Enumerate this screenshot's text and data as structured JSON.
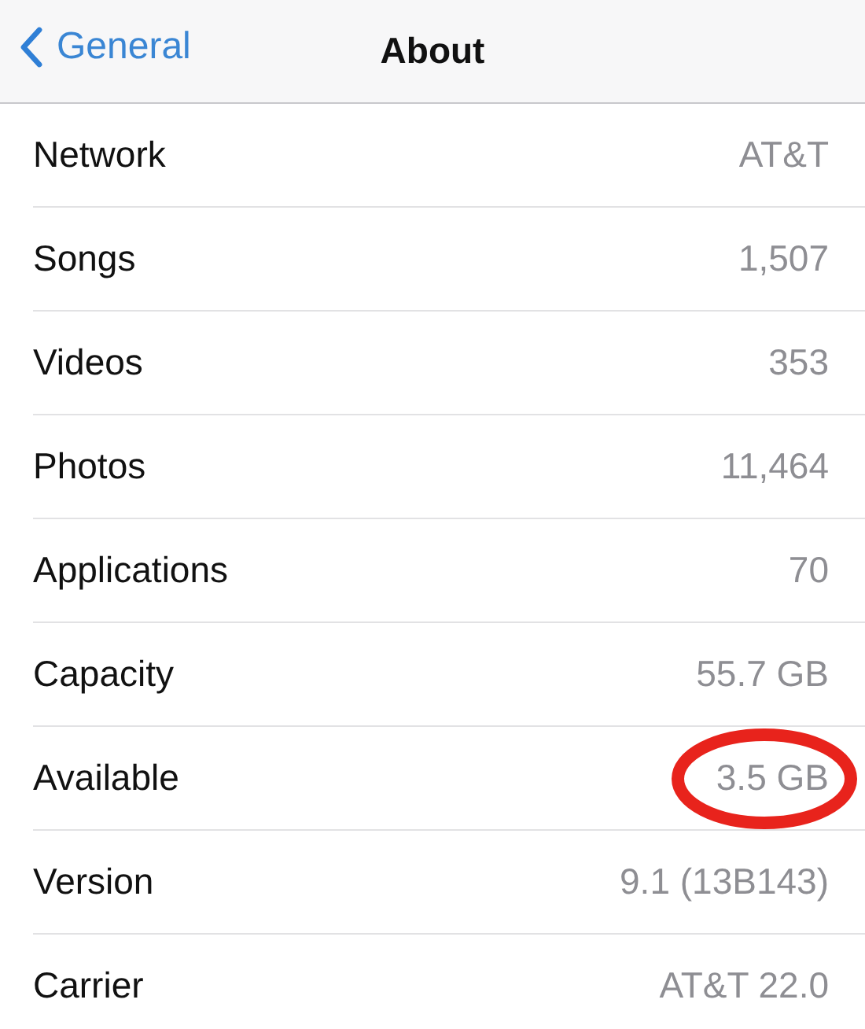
{
  "nav": {
    "back": "General",
    "title": "About"
  },
  "rows": [
    {
      "label": "Network",
      "value": "AT&T",
      "highlighted": false
    },
    {
      "label": "Songs",
      "value": "1,507",
      "highlighted": false
    },
    {
      "label": "Videos",
      "value": "353",
      "highlighted": false
    },
    {
      "label": "Photos",
      "value": "11,464",
      "highlighted": false
    },
    {
      "label": "Applications",
      "value": "70",
      "highlighted": false
    },
    {
      "label": "Capacity",
      "value": "55.7 GB",
      "highlighted": false
    },
    {
      "label": "Available",
      "value": "3.5 GB",
      "highlighted": true
    },
    {
      "label": "Version",
      "value": "9.1 (13B143)",
      "highlighted": false
    },
    {
      "label": "Carrier",
      "value": "AT&T 22.0",
      "highlighted": false
    }
  ]
}
